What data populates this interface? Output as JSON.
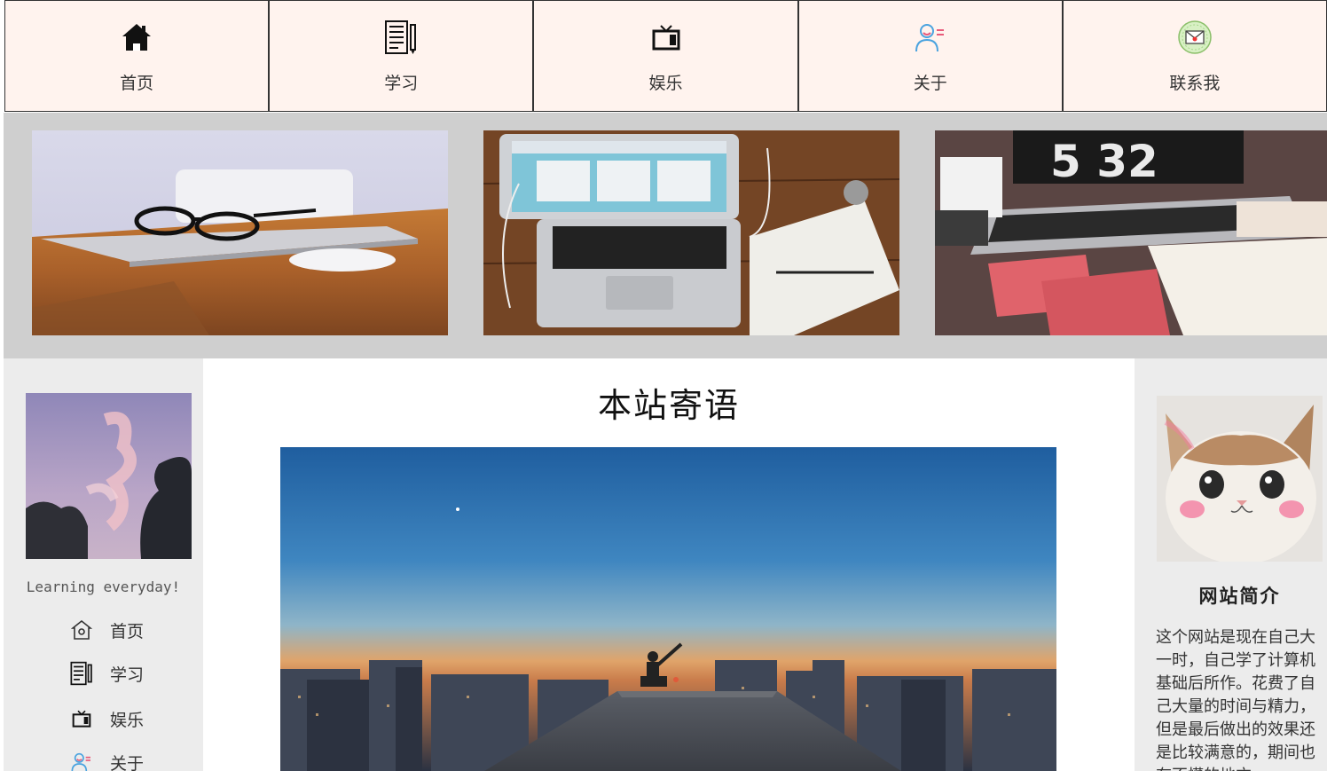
{
  "nav": {
    "items": [
      {
        "label": "首页",
        "icon": "home-icon"
      },
      {
        "label": "学习",
        "icon": "notebook-icon"
      },
      {
        "label": "娱乐",
        "icon": "tv-icon"
      },
      {
        "label": "关于",
        "icon": "user-icon"
      },
      {
        "label": "联系我",
        "icon": "mail-icon"
      }
    ]
  },
  "left": {
    "motto": "Learning everyday!",
    "items": [
      {
        "label": "首页",
        "icon": "home-outline-icon"
      },
      {
        "label": "学习",
        "icon": "notebook-icon"
      },
      {
        "label": "娱乐",
        "icon": "tv-icon"
      },
      {
        "label": "关于",
        "icon": "user-icon"
      }
    ]
  },
  "main": {
    "title": "本站寄语"
  },
  "right": {
    "intro_title": "网站简介",
    "intro_text": "这个网站是现在自己大一时，自己学了计算机基础后所作。花费了自己大量的时间与精力，但是最后做出的效果还是比较满意的，期间也有不懂的地方。"
  },
  "colors": {
    "nav_bg": "#fff3ee",
    "banner_bg": "#cfcfcf",
    "aside_bg": "#ececec"
  }
}
